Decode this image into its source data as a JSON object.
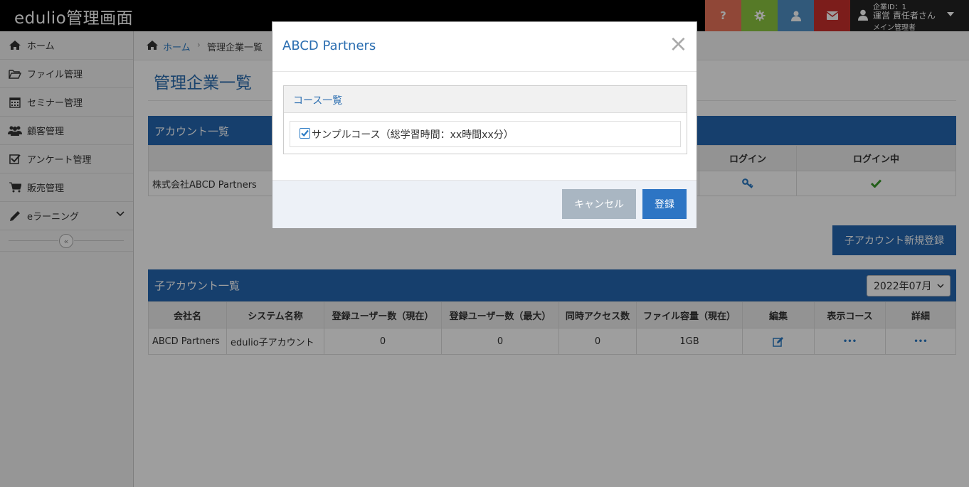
{
  "app": {
    "title": "edulio管理画面"
  },
  "topbar": {
    "account_company_id": "企業ID：1",
    "account_name": "運営 責任者さん",
    "account_role": "メイン管理者",
    "icons": [
      "question-icon",
      "gear-icon",
      "user-icon",
      "mail-icon"
    ],
    "colors": {
      "help": "#e8735a",
      "gear": "#8cc63f",
      "user": "#4f90c6",
      "mail": "#c9302c"
    }
  },
  "sidebar": {
    "items": [
      {
        "label": "ホーム",
        "icon": "home-icon"
      },
      {
        "label": "ファイル管理",
        "icon": "folder-icon"
      },
      {
        "label": "セミナー管理",
        "icon": "calendar-icon"
      },
      {
        "label": "顧客管理",
        "icon": "users-icon"
      },
      {
        "label": "アンケート管理",
        "icon": "checkbox-icon"
      },
      {
        "label": "販売管理",
        "icon": "cart-icon"
      },
      {
        "label": "eラーニング",
        "icon": "pencil-icon"
      }
    ],
    "collapse_symbol": "«"
  },
  "breadcrumb": {
    "home": "ホーム",
    "separator": "›",
    "current": "管理企業一覧"
  },
  "page": {
    "title": "管理企業一覧"
  },
  "account_panel": {
    "title": "アカウント一覧",
    "columns": [
      "",
      "ログイン",
      "ログイン中"
    ],
    "row": {
      "company": "株式会社ABCD Partners"
    }
  },
  "child_new_button": "子アカウント新規登録",
  "child_panel": {
    "title": "子アカウント一覧",
    "month": "2022年07月",
    "columns": [
      "会社名",
      "システム名称",
      "登録ユーザー数（現在）",
      "登録ユーザー数（最大）",
      "同時アクセス数",
      "ファイル容量（現在）",
      "編集",
      "表示コース",
      "詳細"
    ],
    "row": [
      "ABCD Partners",
      "edulio子アカウント",
      "0",
      "0",
      "0",
      "1GB"
    ],
    "more_symbol": "•••"
  },
  "modal": {
    "title": "ABCD Partners",
    "close_symbol": "×",
    "course_list_title": "コース一覧",
    "course_item": "サンプルコース（総学習時間：xx時間xx分）",
    "course_checked": true,
    "cancel_label": "キャンセル",
    "register_label": "登録"
  }
}
